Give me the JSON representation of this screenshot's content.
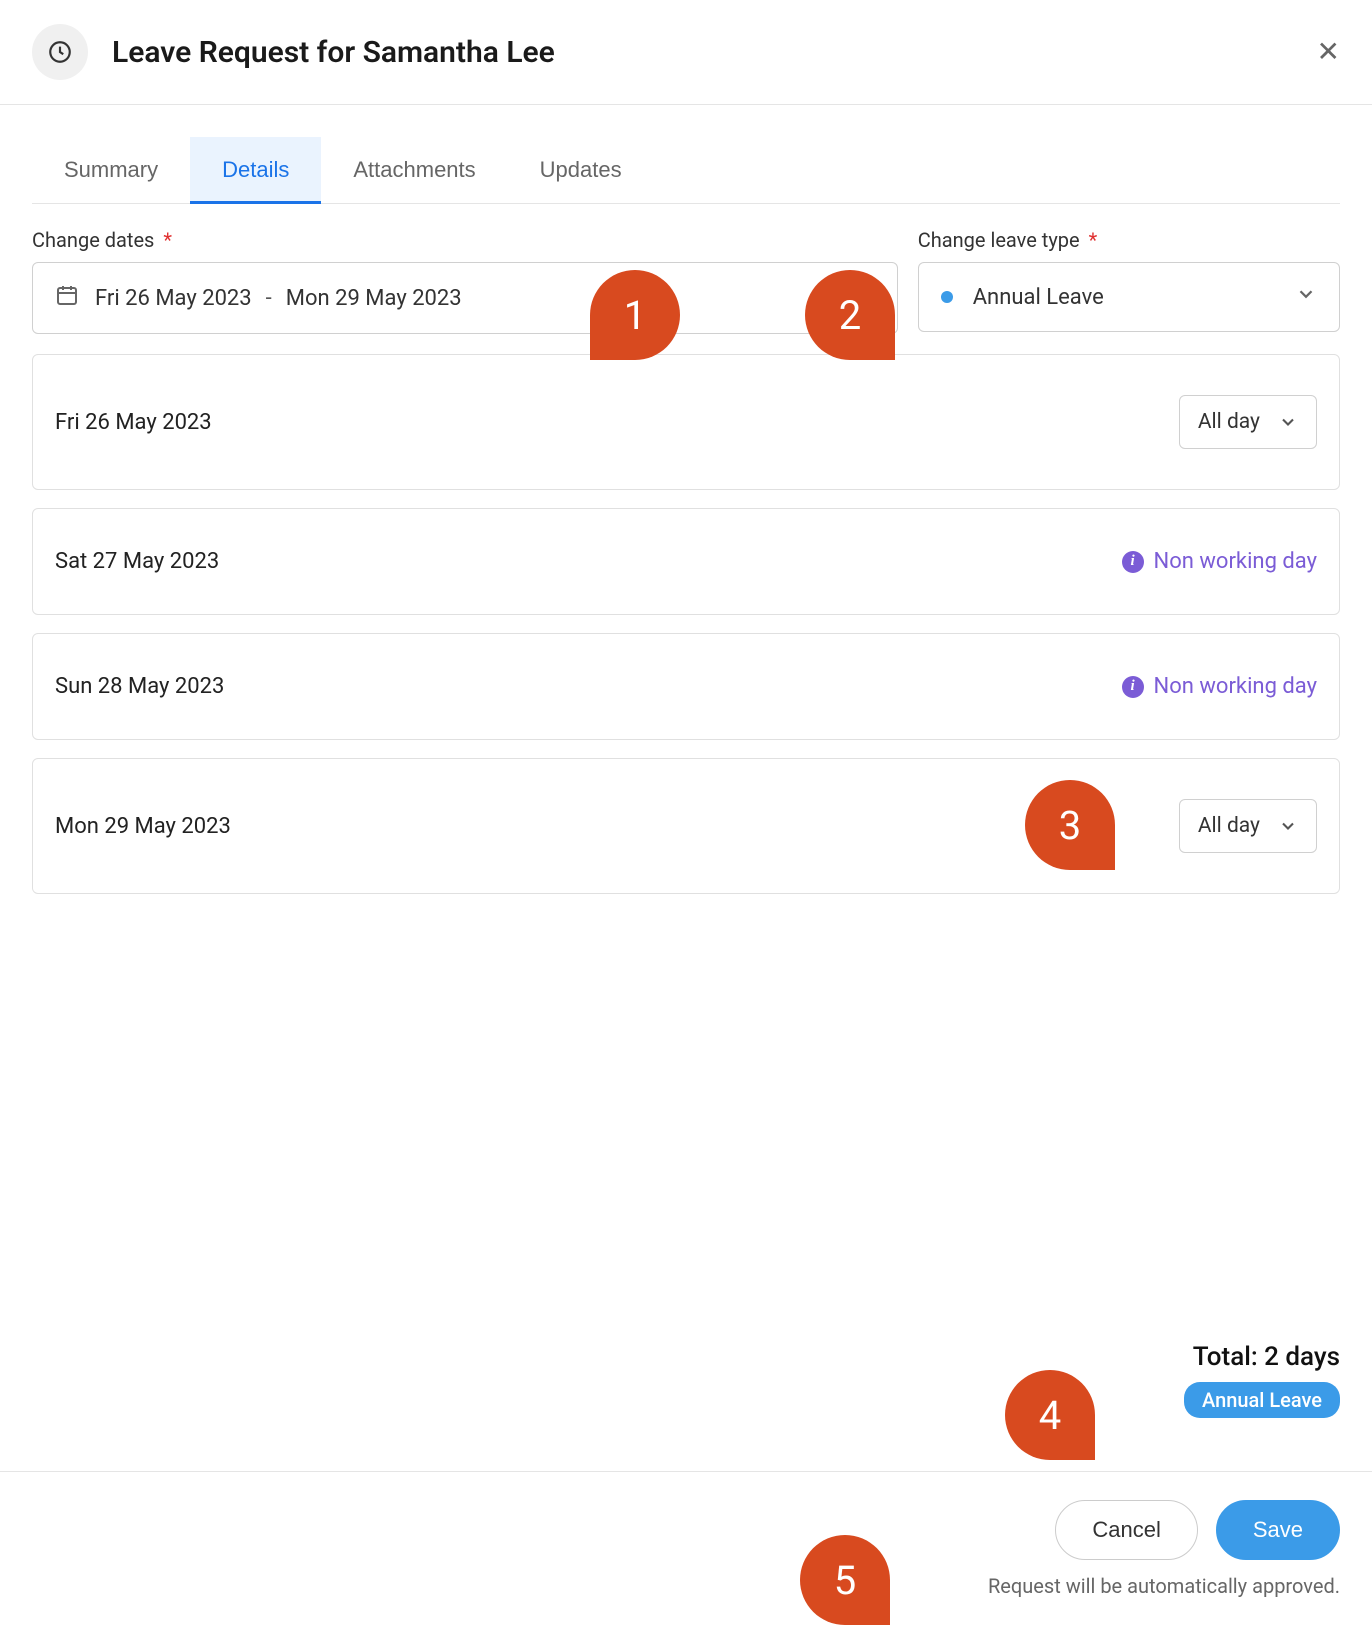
{
  "header": {
    "title": "Leave Request for Samantha Lee"
  },
  "tabs": [
    {
      "label": "Summary",
      "active": false
    },
    {
      "label": "Details",
      "active": true
    },
    {
      "label": "Attachments",
      "active": false
    },
    {
      "label": "Updates",
      "active": false
    }
  ],
  "fields": {
    "dates": {
      "label": "Change dates",
      "required": "*",
      "start": "Fri 26 May 2023",
      "separator": "-",
      "end": "Mon 29 May 2023"
    },
    "leaveType": {
      "label": "Change leave type",
      "required": "*",
      "value": "Annual Leave"
    }
  },
  "days": [
    {
      "date": "Fri 26 May 2023",
      "type": "working",
      "duration": "All day"
    },
    {
      "date": "Sat 27 May 2023",
      "type": "nonworking",
      "note": "Non working day"
    },
    {
      "date": "Sun 28 May 2023",
      "type": "nonworking",
      "note": "Non working day"
    },
    {
      "date": "Mon 29 May 2023",
      "type": "working",
      "duration": "All day"
    }
  ],
  "summary": {
    "total": "Total: 2 days",
    "badge": "Annual Leave"
  },
  "footer": {
    "cancel": "Cancel",
    "save": "Save",
    "note": "Request will be automatically approved."
  },
  "callouts": {
    "c1": "1",
    "c2": "2",
    "c3": "3",
    "c4": "4",
    "c5": "5"
  }
}
